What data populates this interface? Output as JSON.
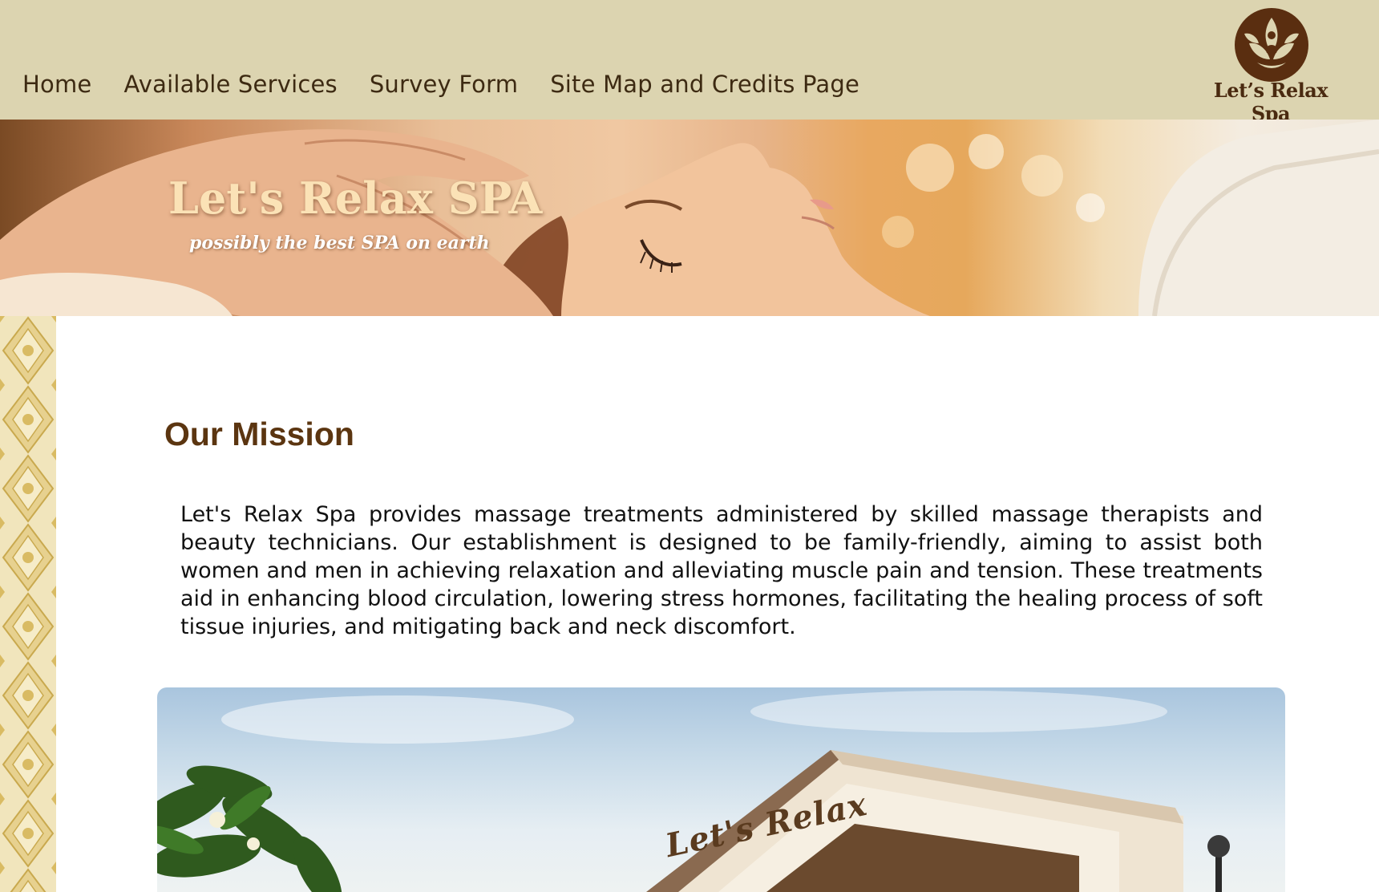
{
  "nav": {
    "items": [
      {
        "label": "Home"
      },
      {
        "label": "Available Services"
      },
      {
        "label": "Survey Form"
      },
      {
        "label": "Site Map and Credits Page"
      }
    ]
  },
  "logo": {
    "text": "Let’s Relax Spa",
    "icon": "lotus-meditation-icon"
  },
  "hero": {
    "title": "Let's Relax SPA",
    "subtitle": "possibly the best SPA on earth"
  },
  "mission": {
    "heading": "Our Mission",
    "body": "Let's Relax Spa provides massage treatments administered by skilled massage therapists and beauty technicians. Our establishment is designed to be family-friendly, aiming to assist both women and men in achieving relaxation and alleviating muscle pain and tension. These treatments aid in enhancing blood circulation, lowering stress hormones, facilitating the healing process of soft tissue injuries, and mitigating back and neck discomfort."
  },
  "photo": {
    "sign_text": "Let's Relax"
  },
  "colors": {
    "topbar": "#dcd4b0",
    "nav_text": "#3d2a12",
    "heading": "#5b3510",
    "ornament": "#efe2b4"
  }
}
